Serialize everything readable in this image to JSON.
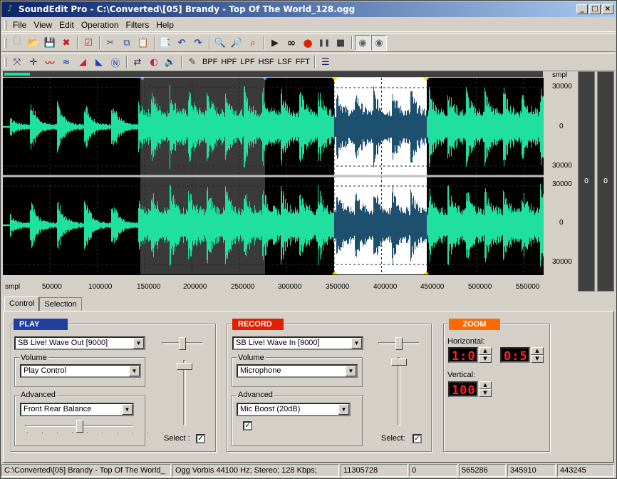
{
  "window": {
    "title": "SoundEdit Pro - C:\\Converted\\[05] Brandy - Top Of The World_128.ogg",
    "buttons": {
      "minimize": "_",
      "maximize": "□",
      "close": "×"
    }
  },
  "menu": [
    "File",
    "View",
    "Edit",
    "Operation",
    "Filters",
    "Help"
  ],
  "toolbar1": [
    {
      "name": "new-file-icon",
      "glyph": "🗋"
    },
    {
      "name": "open-folder-icon",
      "glyph": "📂"
    },
    {
      "name": "save-icon",
      "glyph": "💾"
    },
    {
      "name": "delete-icon",
      "glyph": "✖"
    },
    {
      "name": "checklist-icon",
      "glyph": "☑"
    },
    {
      "name": "cut-icon",
      "glyph": "✂"
    },
    {
      "name": "copy-icon",
      "glyph": "⧉"
    },
    {
      "name": "paste-icon",
      "glyph": "📋"
    },
    {
      "name": "paste-new-icon",
      "glyph": "📑"
    },
    {
      "name": "undo-icon",
      "glyph": "↶"
    },
    {
      "name": "redo-icon",
      "glyph": "↷"
    },
    {
      "name": "zoom-in-icon",
      "glyph": "🔍"
    },
    {
      "name": "zoom-out-icon",
      "glyph": "🔎"
    },
    {
      "name": "zoom-full-icon",
      "glyph": "⌕"
    },
    {
      "name": "play-icon",
      "glyph": "▶"
    },
    {
      "name": "loop-icon",
      "glyph": "∞"
    },
    {
      "name": "record-icon",
      "glyph": "●"
    },
    {
      "name": "pause-icon",
      "glyph": "❚❚"
    },
    {
      "name": "stop-icon",
      "glyph": "■"
    },
    {
      "name": "speaker-left-icon",
      "glyph": "◉"
    },
    {
      "name": "speaker-right-icon",
      "glyph": "◉"
    }
  ],
  "toolbar2": [
    {
      "name": "expand-icon",
      "glyph": "⤧"
    },
    {
      "name": "split-icon",
      "glyph": "✛"
    },
    {
      "name": "wave-red-icon",
      "glyph": "〰"
    },
    {
      "name": "wave-flat-icon",
      "glyph": "≈"
    },
    {
      "name": "fade-in-icon",
      "glyph": "◢"
    },
    {
      "name": "fade-out-icon",
      "glyph": "◣"
    },
    {
      "name": "normalize-icon",
      "glyph": "Ⓝ"
    },
    {
      "name": "swap-channels-icon",
      "glyph": "⇄"
    },
    {
      "name": "mute-icon",
      "glyph": "◐"
    },
    {
      "name": "volume-icon",
      "glyph": "🔊"
    },
    {
      "name": "pencil-icon",
      "glyph": "✎"
    },
    {
      "name": "bpf",
      "label": "BPF"
    },
    {
      "name": "hpf",
      "label": "HPF"
    },
    {
      "name": "lpf",
      "label": "LPF"
    },
    {
      "name": "hsf",
      "label": "HSF"
    },
    {
      "name": "lsf",
      "label": "LSF"
    },
    {
      "name": "fft",
      "label": "FFT"
    },
    {
      "name": "equalizer-icon",
      "glyph": "☰"
    }
  ],
  "waveform": {
    "y_unit": "smpl",
    "x_unit": "smpl",
    "y_ticks_top": [
      "30000",
      "0",
      "30000"
    ],
    "y_ticks_bottom": [
      "30000",
      "0",
      "30000"
    ],
    "x_ticks": [
      "50000",
      "100000",
      "150000",
      "200000",
      "250000",
      "300000",
      "350000",
      "400000",
      "450000",
      "500000",
      "550000"
    ],
    "meter_left": "0",
    "meter_right": "0"
  },
  "tabs": [
    "Control",
    "Selection"
  ],
  "play": {
    "title": "PLAY",
    "device": "SB Live! Wave Out [9000]",
    "volume_label": "Volume",
    "volume_value": "Play Control",
    "advanced_label": "Advanced",
    "advanced_value": "Front Rear Balance",
    "select_label": "Select :",
    "select_checked": "✓"
  },
  "record": {
    "title": "RECORD",
    "device": "SB Live! Wave In [9000]",
    "volume_label": "Volume",
    "volume_value": "Microphone",
    "advanced_label": "Advanced",
    "advanced_value": "Mic Boost (20dB)",
    "advanced_checked": "✓",
    "select_label": "Select:",
    "select_checked": "✓"
  },
  "zoom": {
    "title": "ZOOM",
    "horizontal_label": "Horizontal:",
    "horizontal_value1": "1:0",
    "horizontal_value2": "0:5",
    "vertical_label": "Vertical:",
    "vertical_value": "100"
  },
  "status": {
    "file": "C:\\Converted\\[05] Brandy - Top Of The World_",
    "format": "Ogg Vorbis  44100 Hz; Stereo; 128 Kbps;",
    "length": "11305728",
    "pos": "0",
    "sel_start": "565286",
    "sel_len": "345910",
    "sel_end": "443245"
  },
  "colors": {
    "wave": "#20e0a0",
    "selection_bg": "#ffffff",
    "selection_wave": "#1d4f6f",
    "highlight": "#3a3a3a"
  }
}
